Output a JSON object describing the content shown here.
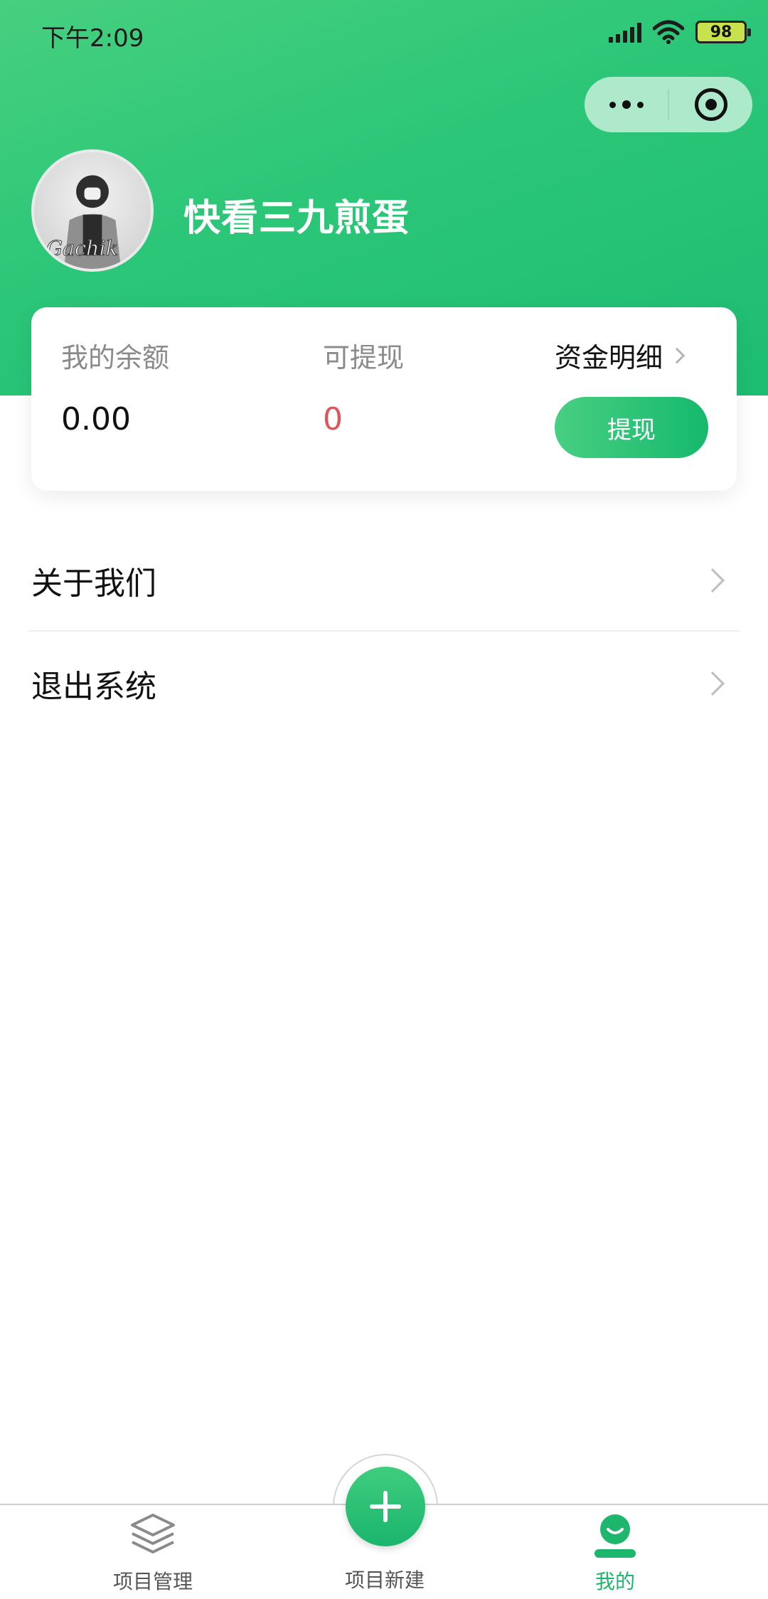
{
  "status_bar": {
    "time": "下午2:09",
    "battery": "98",
    "icons": [
      "signal-icon",
      "wifi-icon",
      "battery-icon"
    ]
  },
  "capsule": {
    "icons": [
      "more-icon",
      "close-target-icon"
    ]
  },
  "profile": {
    "username": "快看三九煎蛋"
  },
  "card": {
    "balance_label": "我的余额",
    "balance_value": "0.00",
    "withdrawable_label": "可提现",
    "withdrawable_value": "0",
    "detail_link": "资金明细",
    "withdraw_button": "提现"
  },
  "menu": [
    {
      "label": "关于我们"
    },
    {
      "label": "退出系统"
    }
  ],
  "tabbar": [
    {
      "label": "项目管理",
      "icon": "layers-icon",
      "active": false
    },
    {
      "label": "项目新建",
      "icon": "plus-icon",
      "active": false
    },
    {
      "label": "我的",
      "icon": "user-icon",
      "active": true
    }
  ],
  "colors": {
    "brand_green": "#1dbd72",
    "accent_red": "#e0545b",
    "active_tab": "#1cb66c"
  }
}
